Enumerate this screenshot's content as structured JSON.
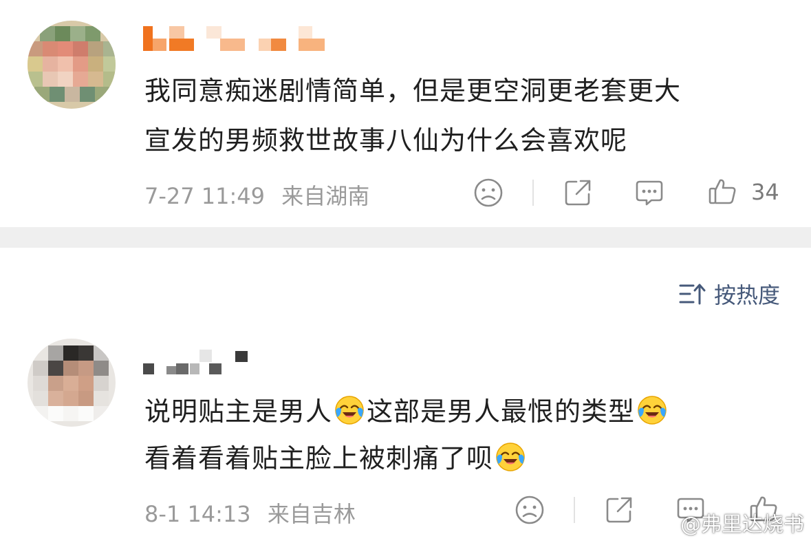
{
  "comments": [
    {
      "text_line1": "我同意痴迷剧情简单，但是更空洞更老套更大",
      "text_line2": "宣发的男频救世故事八仙为什么会喜欢呢",
      "time": "7-27 11:49",
      "location": "来自湖南",
      "likes": "34"
    },
    {
      "text_line1_a": "说明贴主是男人",
      "text_line1_b": "这部是男人最恨的类型",
      "text_line2": "看着看着贴主脸上被刺痛了呗",
      "time": "8-1 14:13",
      "location": "来自吉林",
      "likes": ""
    }
  ],
  "sort": {
    "label": "按热度"
  },
  "watermark": {
    "text": "@弗里达烧书"
  },
  "icons": {
    "dislike": "sad-face-icon",
    "share": "share-icon",
    "comment": "comment-icon",
    "like": "thumbs-up-icon",
    "sort": "sort-icon",
    "emoji": "laugh-cry-emoji-icon"
  },
  "colors": {
    "meta_text": "#9a9a9a",
    "sort_text": "#46597a",
    "separator": "#efefef"
  }
}
